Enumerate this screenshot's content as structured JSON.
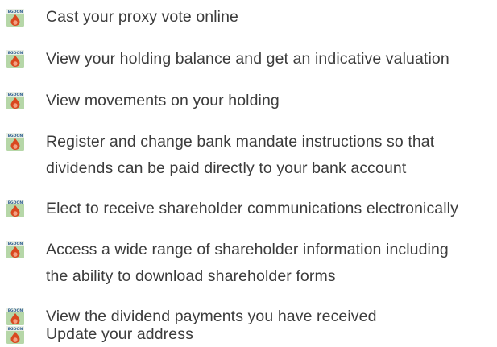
{
  "logo": {
    "icon": "egdon-logo-icon",
    "lettering": "EGDON",
    "colors": {
      "background": "#b6d7a8",
      "band": "#e9efe6",
      "lettering": "#2f5f8f",
      "drop": "#d9481f",
      "drop_highlight": "#f3a183"
    }
  },
  "benefits": [
    {
      "lines": [
        "Cast your proxy vote online"
      ]
    },
    {
      "lines": [
        "View your holding balance and get an indicative valuation"
      ]
    },
    {
      "lines": [
        "View movements on your holding"
      ]
    },
    {
      "lines": [
        "Register and change bank mandate instructions so that",
        "dividends can be paid directly to your bank account"
      ]
    },
    {
      "lines": [
        "Elect to receive shareholder communications electronically"
      ]
    },
    {
      "lines": [
        "Access a wide range of shareholder information including",
        "the ability to download shareholder forms"
      ]
    },
    {
      "lines": [
        "View the dividend payments you have received"
      ]
    },
    {
      "lines": [
        "Update your address"
      ]
    }
  ]
}
